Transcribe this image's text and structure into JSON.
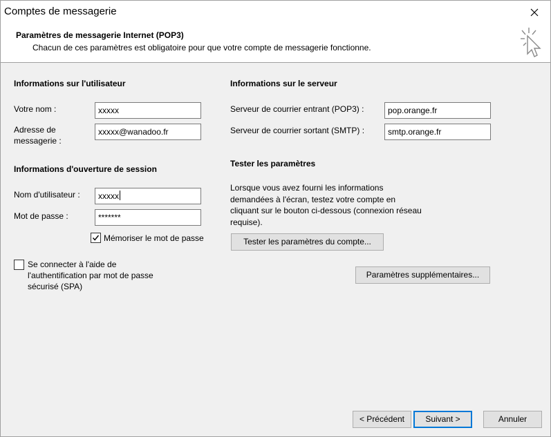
{
  "window": {
    "title": "Comptes de messagerie"
  },
  "header": {
    "title": "Paramètres de messagerie Internet (POP3)",
    "subtitle": "Chacun de ces paramètres est obligatoire pour que votre compte de messagerie fonctionne."
  },
  "user_info": {
    "section_title": "Informations sur l'utilisateur",
    "name_label": "Votre nom :",
    "name_value": "xxxxx",
    "email_label_line1": "Adresse de",
    "email_label_line2": "messagerie :",
    "email_value": "xxxxx@wanadoo.fr"
  },
  "server_info": {
    "section_title": "Informations sur le serveur",
    "incoming_label": "Serveur de courrier entrant (POP3) :",
    "incoming_value": "pop.orange.fr",
    "outgoing_label": "Serveur de courrier sortant (SMTP) :",
    "outgoing_value": "smtp.orange.fr"
  },
  "login_info": {
    "section_title": "Informations d'ouverture de session",
    "username_label": "Nom d'utilisateur :",
    "username_value": "xxxxx",
    "password_label": "Mot de passe :",
    "password_value": "*******",
    "remember_label": "Mémoriser le mot de passe",
    "remember_checked": true,
    "spa_line1": "Se connecter à l'aide de",
    "spa_line2": "l'authentification par mot de passe",
    "spa_line3": "sécurisé (SPA)",
    "spa_checked": false
  },
  "test_settings": {
    "section_title": "Tester les paramètres",
    "desc_line1": "Lorsque vous avez fourni les informations",
    "desc_line2": "demandées à l'écran, testez votre compte en",
    "desc_line3": "cliquant sur le bouton ci-dessous (connexion réseau",
    "desc_line4": "requise).",
    "test_button": "Tester les paramètres du compte..."
  },
  "more_settings_button": "Paramètres supplémentaires...",
  "footer": {
    "back_button": "< Précédent",
    "next_button": "Suivant >",
    "cancel_button": "Annuler"
  },
  "colors": {
    "accent": "#0078d7",
    "background": "#f0f0f0"
  }
}
